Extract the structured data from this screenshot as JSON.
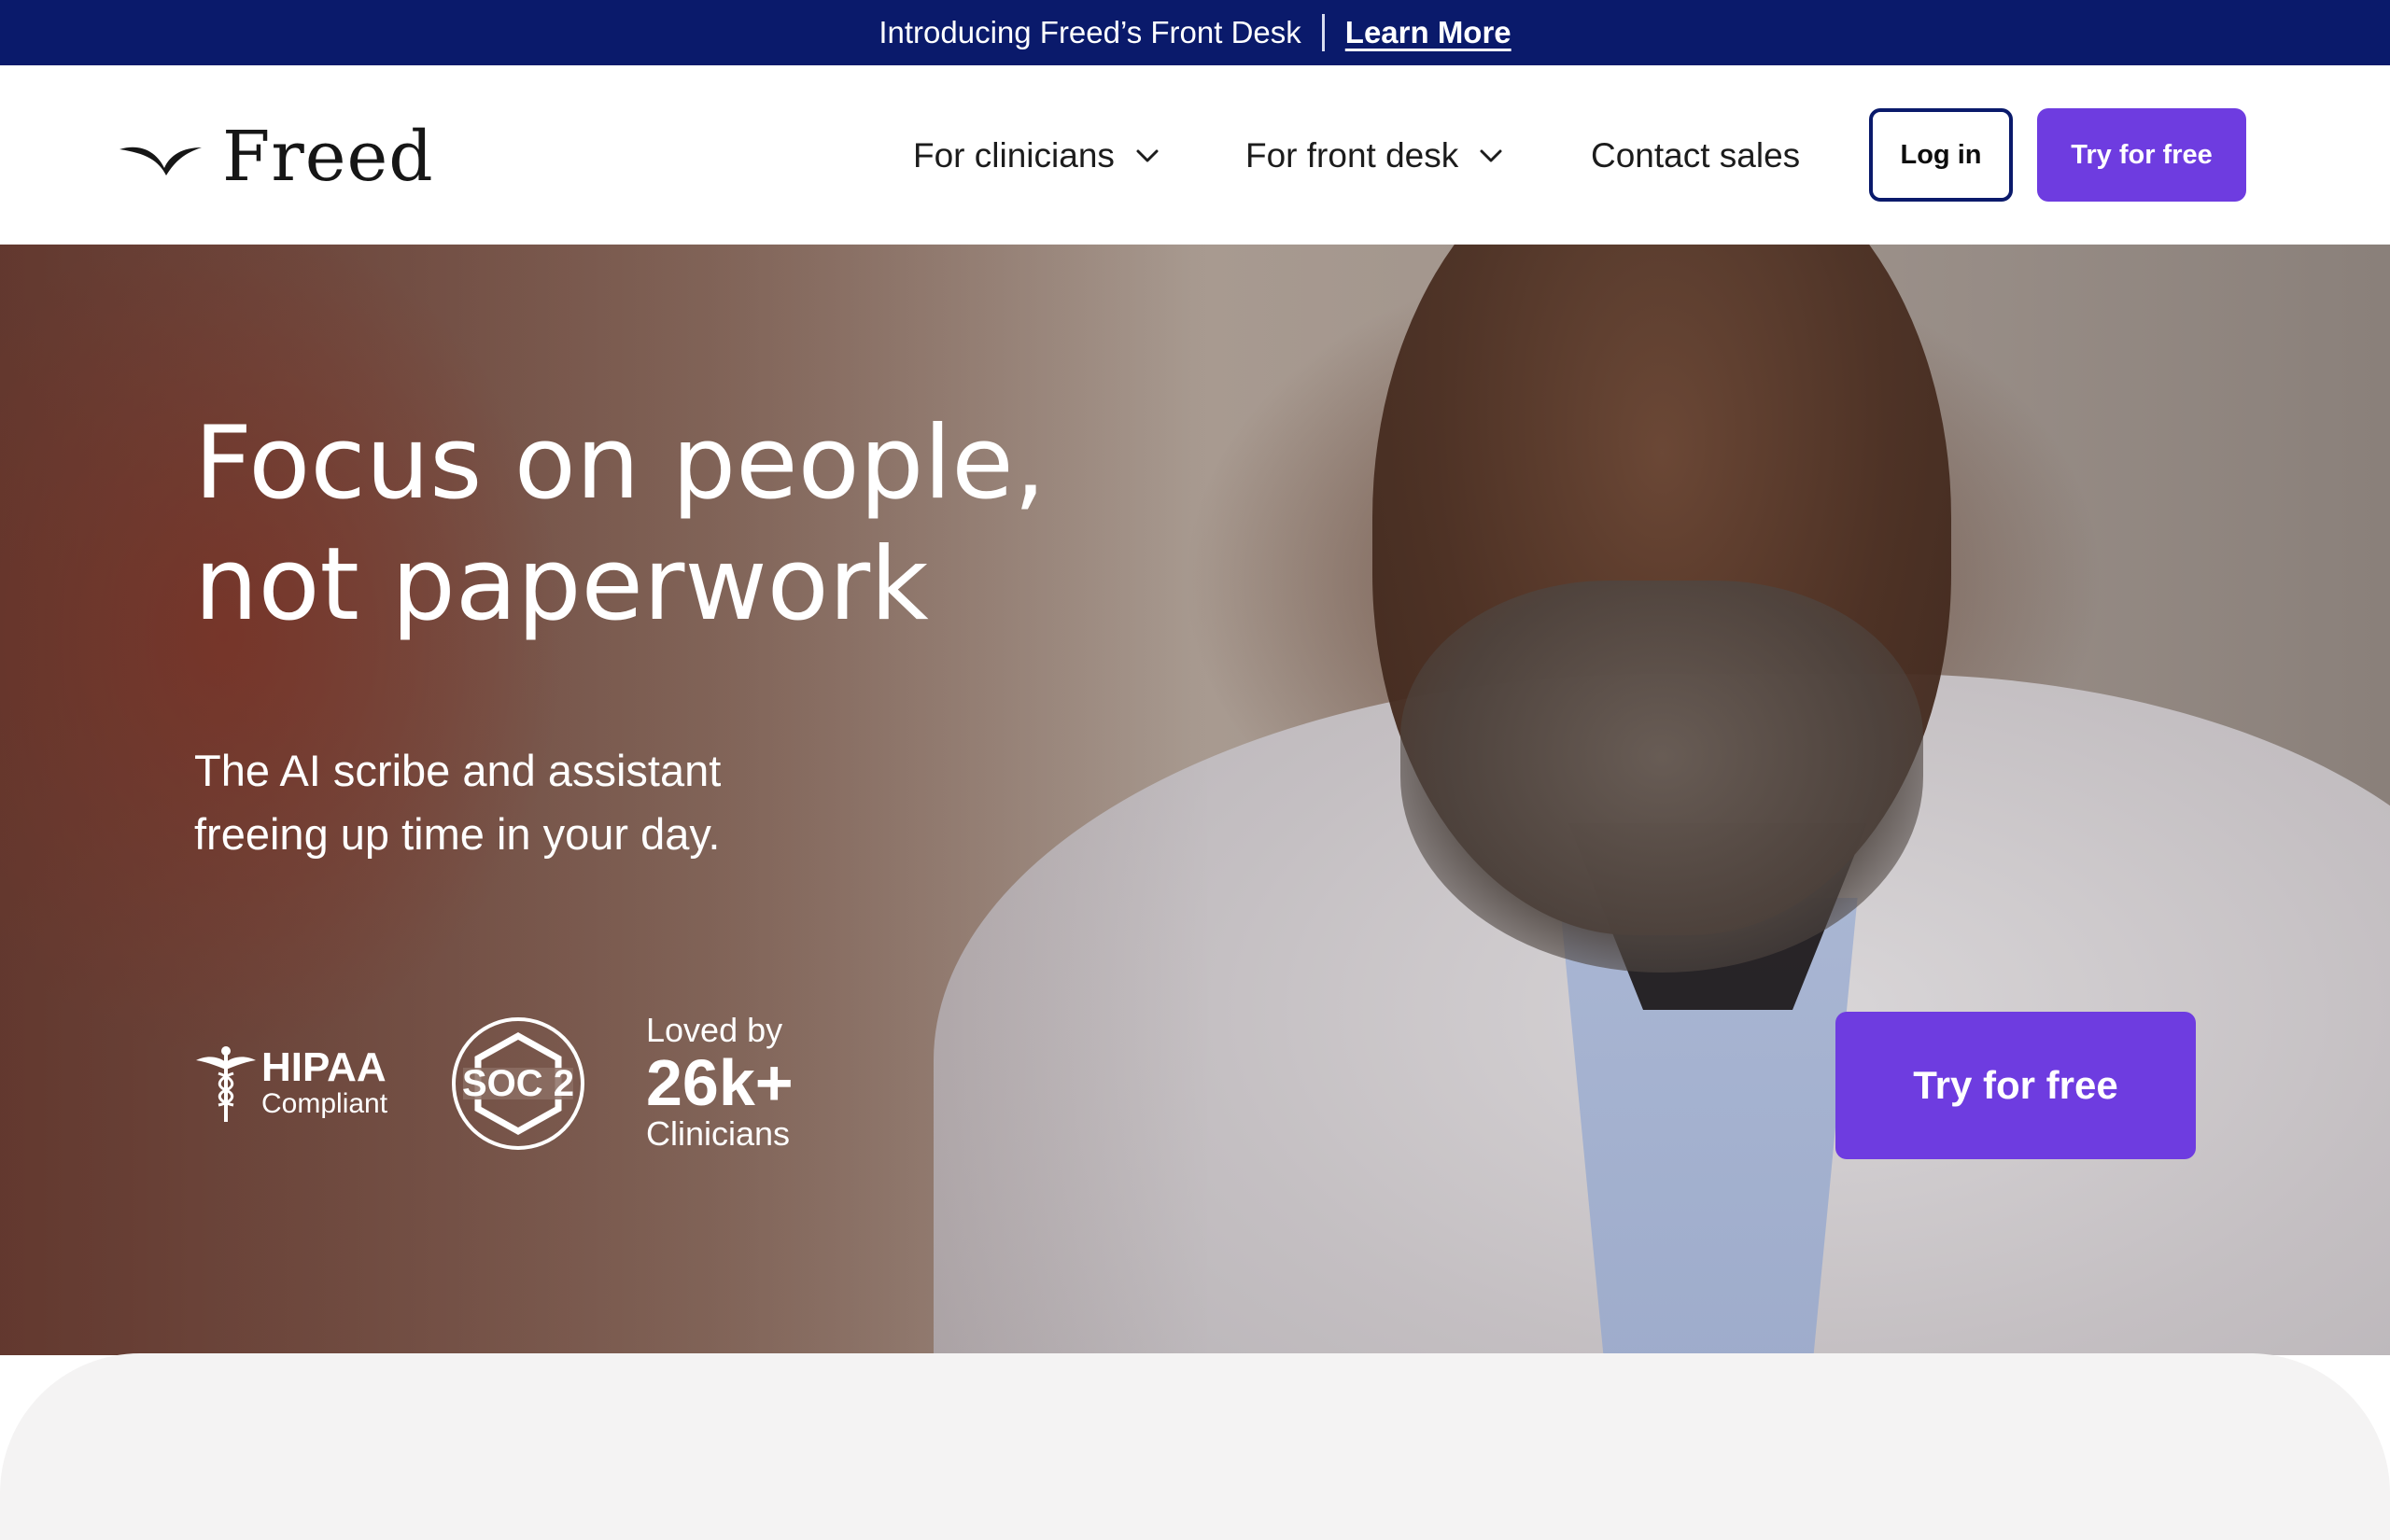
{
  "announcement": {
    "text": "Introducing Freed’s Front Desk",
    "link_label": "Learn More"
  },
  "header": {
    "logo_text": "Freed",
    "nav": {
      "clinicians": "For clinicians",
      "front_desk": "For front desk",
      "contact": "Contact sales"
    },
    "login_label": "Log in",
    "try_label": "Try for free"
  },
  "hero": {
    "title_line1": "Focus on people,",
    "title_line2": "not paperwork",
    "subtitle_line1": "The AI scribe and assistant",
    "subtitle_line2": "freeing up time in your day.",
    "hipaa_title": "HIPAA",
    "hipaa_sub": "Compliant",
    "soc_label": "SOC 2",
    "loved_by": "Loved by",
    "loved_count": "26k+",
    "loved_unit": "Clinicians",
    "cta_label": "Try for free"
  },
  "colors": {
    "announcement_bg": "#0a1a6b",
    "primary_button": "#6e3ce0",
    "login_border": "#0a1a6b",
    "bottom_panel": "#f4f3f3"
  },
  "icons": {
    "logo": "freed-wing-logo-icon",
    "dropdown": "chevron-down-icon",
    "hipaa": "caduceus-icon",
    "soc": "soc2-badge-icon"
  }
}
